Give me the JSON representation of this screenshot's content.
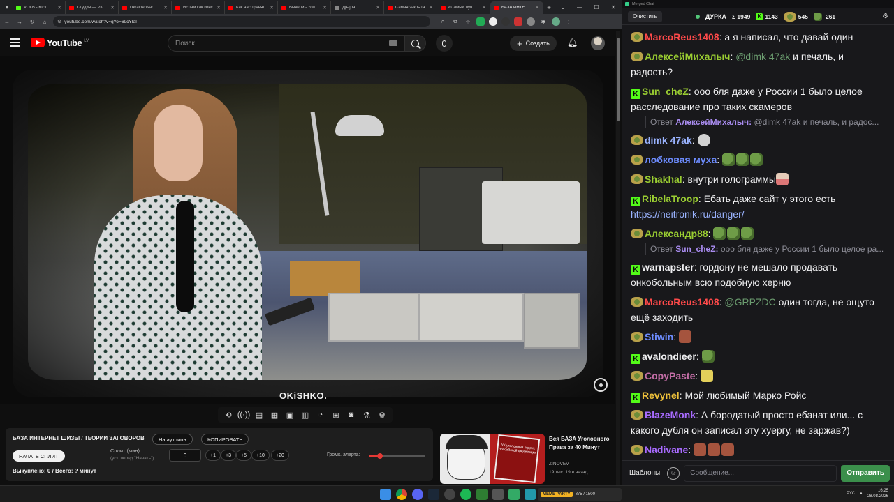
{
  "browser": {
    "tabs": [
      {
        "label": "VODs - Kick Dash",
        "favicon": "kick-icon",
        "active": false
      },
      {
        "label": "Студия — VK Видео",
        "favicon": "youtube-icon",
        "active": false
      },
      {
        "label": "Ukraine War Exp",
        "favicon": "youtube-icon",
        "active": false
      },
      {
        "label": "Ислам как конс",
        "favicon": "youtube-icon",
        "active": false
      },
      {
        "label": "Как нас травят",
        "favicon": "youtube-icon",
        "active": false
      },
      {
        "label": "Вывели - YouT",
        "favicon": "youtube-icon",
        "active": false
      },
      {
        "label": "Д[ы]ра",
        "favicon": "globe-icon",
        "active": false
      },
      {
        "label": "Самая закрыта",
        "favicon": "youtube-icon",
        "active": false
      },
      {
        "label": "«Самый лучший",
        "favicon": "youtube-icon",
        "active": false
      },
      {
        "label": "БАЗА ИНТЕ",
        "favicon": "youtube-icon",
        "active": true
      }
    ],
    "url": "youtube.com/watch?v=qYoF69cYIaI"
  },
  "youtube": {
    "logo_text": "YouTube",
    "region": "LV",
    "search_placeholder": "Поиск",
    "create_label": "Создать",
    "watermark": "OKiSHKO.",
    "panel": {
      "title": "БАЗА ИНТЕРНЕТ ШИЗЫ / ТЕОРИИ ЗАГОВОРОВ",
      "auction_label": "На аукцион",
      "copy_label": "КОПИРОВАТЬ",
      "start_split_label": "НАЧАТЬ СПЛИТ",
      "split_label": "Сплит (мин):",
      "split_hint": "(уст. перед \"Начать\")",
      "split_value": "0",
      "increments": [
        "+1",
        "+3",
        "+5",
        "+10",
        "+20"
      ],
      "bought_text": "Выкуплено: 0 / Всего: ? минут",
      "alert_volume_label": "Громк. алерта:",
      "alert_volume": 0.2
    },
    "related": {
      "title": "Вся БАЗА Уголовного Права за 40 Минут",
      "channel": "ZINOVEV",
      "meta": "19 тыс.   19 ч назад",
      "thumb_book_text": "УК уголовный кодекс российской федерации"
    }
  },
  "chat": {
    "window_title": "Merged Chat",
    "clear_label": "Очистить",
    "channel": "ДУРКА",
    "stats": {
      "total": "Σ 1949",
      "kick": "1143",
      "youtube": "545",
      "other": "261"
    },
    "messages": [
      {
        "platform": "youtube",
        "name": "MarcoReus1408",
        "color": "#ff4a4a",
        "text": "а я написал, что давай один"
      },
      {
        "platform": "youtube",
        "name": "АлексейМихалыч",
        "color": "#9acd32",
        "mention": "@dimk 47ak",
        "text": "и печаль, и радость?"
      },
      {
        "platform": "kick",
        "name": "Sun_cheZ",
        "color": "#9acd32",
        "text": "ооо бля даже у России 1 было целое расследование про таких скамеров"
      },
      {
        "reply": true,
        "prefix": "Ответ",
        "name": "АлексейМихалыч:",
        "name_color": "#a98cf0",
        "mention": "@dimk 47ak",
        "text": "и печаль, и радос..."
      },
      {
        "platform": "youtube",
        "name": "dimk 47ak",
        "color": "#9ab3ff",
        "emotes": [
          "face"
        ]
      },
      {
        "platform": "youtube",
        "name": "лобковая муха",
        "color": "#6d8cff",
        "emotes": [
          "pepe",
          "pepe",
          "pepe"
        ]
      },
      {
        "platform": "youtube",
        "name": "Shakhal",
        "color": "#9acd32",
        "text": "внутри голограммы",
        "emotes": [
          "man"
        ]
      },
      {
        "platform": "kick",
        "name": "RibelaTroop",
        "color": "#9acd32",
        "text": "Ебать даже сайт у этого есть",
        "link": "https://neitronik.ru/danger/"
      },
      {
        "platform": "youtube",
        "name": "Александр88",
        "color": "#9acd32",
        "emotes": [
          "pepe",
          "pepe",
          "pepe"
        ]
      },
      {
        "reply": true,
        "prefix": "Ответ",
        "name": "Sun_cheZ:",
        "name_color": "#a98cf0",
        "text": "ооо бля даже у России 1 было целое ра..."
      },
      {
        "platform": "kick",
        "name": "warnapster",
        "color": "#efeff1",
        "text": "гордону не мешало продавать онкобольным всю подобную херню"
      },
      {
        "platform": "youtube",
        "name": "MarcoReus1408",
        "color": "#ff4a4a",
        "mention": "@GRPZDC",
        "text": "один тогда, не ощуто ещё заходить"
      },
      {
        "platform": "youtube",
        "name": "Stiwin",
        "color": "#6d8cff",
        "emotes": [
          "red"
        ]
      },
      {
        "platform": "kick",
        "name": "avalondieer",
        "color": "#efeff1",
        "emotes": [
          "pepe"
        ]
      },
      {
        "platform": "youtube",
        "name": "CopyPaste",
        "color": "#c46ea7",
        "emotes": [
          "doge"
        ]
      },
      {
        "platform": "kick",
        "name": "Revynel",
        "color": "#f0c23b",
        "text": "Мой любимый Марко Ройс"
      },
      {
        "platform": "youtube",
        "name": "BlazeMonk",
        "color": "#a86bff",
        "text": "А бородатый просто ебанат или... с какого дубля он записал эту хуергу, не заржав?)"
      },
      {
        "platform": "youtube",
        "name": "Nadivane",
        "color": "#a86bff",
        "emotes": [
          "red",
          "red",
          "red"
        ]
      }
    ],
    "templates_label": "Шаблоны",
    "input_placeholder": "Сообщение...",
    "send_label": "Отправить"
  },
  "taskbar": {
    "stream_label": "MEME PARTY",
    "stream_progress": "875 / 1500",
    "lang": "РУС",
    "time": "16:25",
    "date": "28.08.2026"
  }
}
